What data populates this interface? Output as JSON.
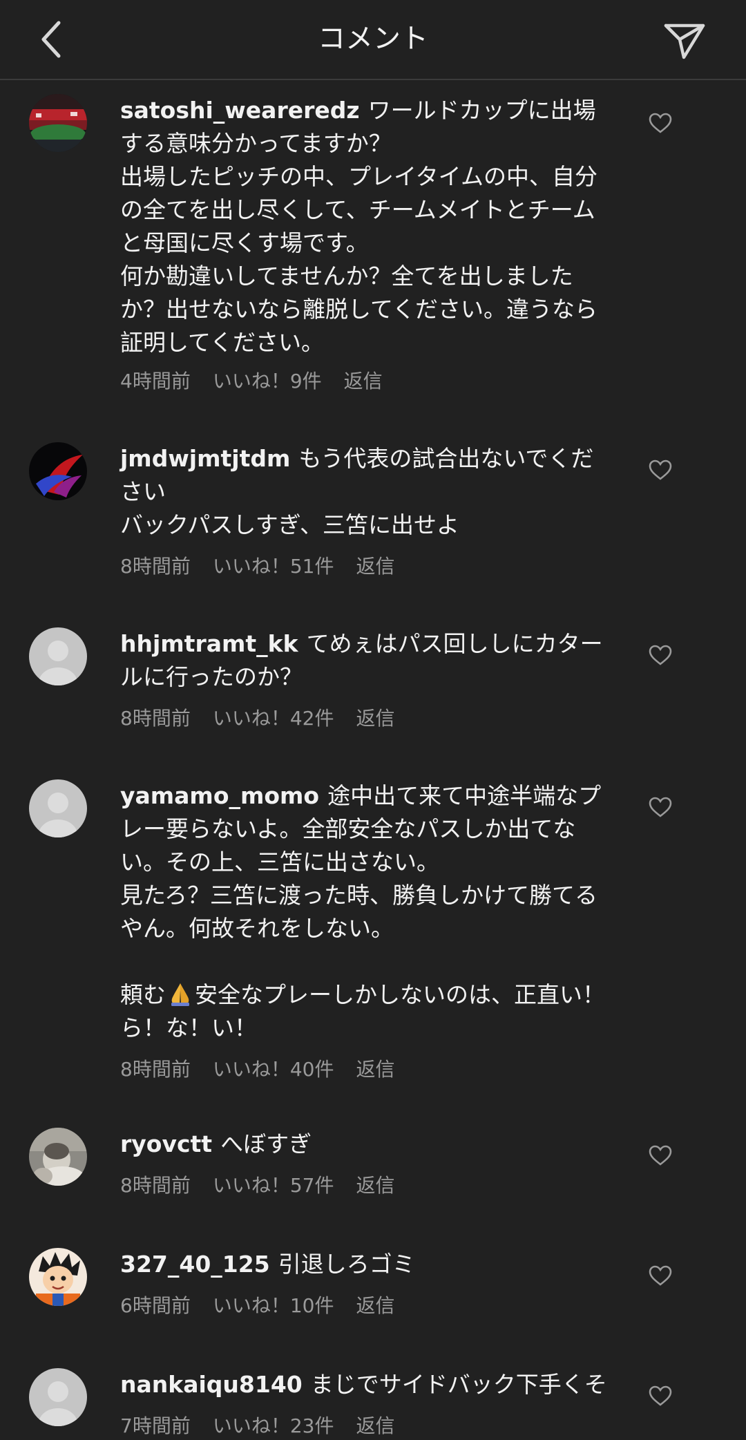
{
  "header": {
    "title": "コメント",
    "back_icon": "chevron-left-icon",
    "share_icon": "paper-plane-icon"
  },
  "comments": [
    {
      "username": "satoshi_weareredz",
      "text": "ワールドカップに出場する意味分かってますか？\n出場したピッチの中、プレイタイムの中、自分の全てを出し尽くして、チームメイトとチームと母国に尽くす場です。\n何か勘違いしてませんか？全てを出しましたか？出せないなら離脱してください。違うなら証明してください。",
      "time": "4時間前",
      "likes": "いいね！9件",
      "reply": "返信"
    },
    {
      "username": "jmdwjmtjtdm",
      "text": "もう代表の試合出ないでください\nバックパスしすぎ、三笘に出せよ",
      "time": "8時間前",
      "likes": "いいね！51件",
      "reply": "返信"
    },
    {
      "username": "hhjmtramt_kk",
      "text": "てめぇはパス回ししにカタールに行ったのか？",
      "time": "8時間前",
      "likes": "いいね！42件",
      "reply": "返信"
    },
    {
      "username": "yamamo_momo",
      "text_before_emoji": "途中出て来て中途半端なプレー要らないよ。全部安全なパスしか出てない。その上、三笘に出さない。\n見たろ？三笘に渡った時、勝負しかけて勝てるやん。何故それをしない。\n\n頼む",
      "emoji": "folded-hands-emoji",
      "text_after_emoji": "安全なプレーしかしないのは、正直い！ら！な！い！",
      "time": "8時間前",
      "likes": "いいね！40件",
      "reply": "返信"
    },
    {
      "username": "ryovctt",
      "text": "へぼすぎ",
      "time": "8時間前",
      "likes": "いいね！57件",
      "reply": "返信"
    },
    {
      "username": "327_40_125",
      "text": "引退しろゴミ",
      "time": "6時間前",
      "likes": "いいね！10件",
      "reply": "返信"
    },
    {
      "username": "nankaiqu8140",
      "text": "まじでサイドバック下手くそ",
      "time": "7時間前",
      "likes": "いいね！23件",
      "reply": "返信"
    }
  ],
  "icons": {
    "like": "heart-outline-icon",
    "avatar_default": "default-avatar-icon"
  },
  "colors": {
    "background": "#212121",
    "text": "#f2f2f2",
    "meta": "#9a9a9a",
    "divider": "#3b3b3b"
  }
}
